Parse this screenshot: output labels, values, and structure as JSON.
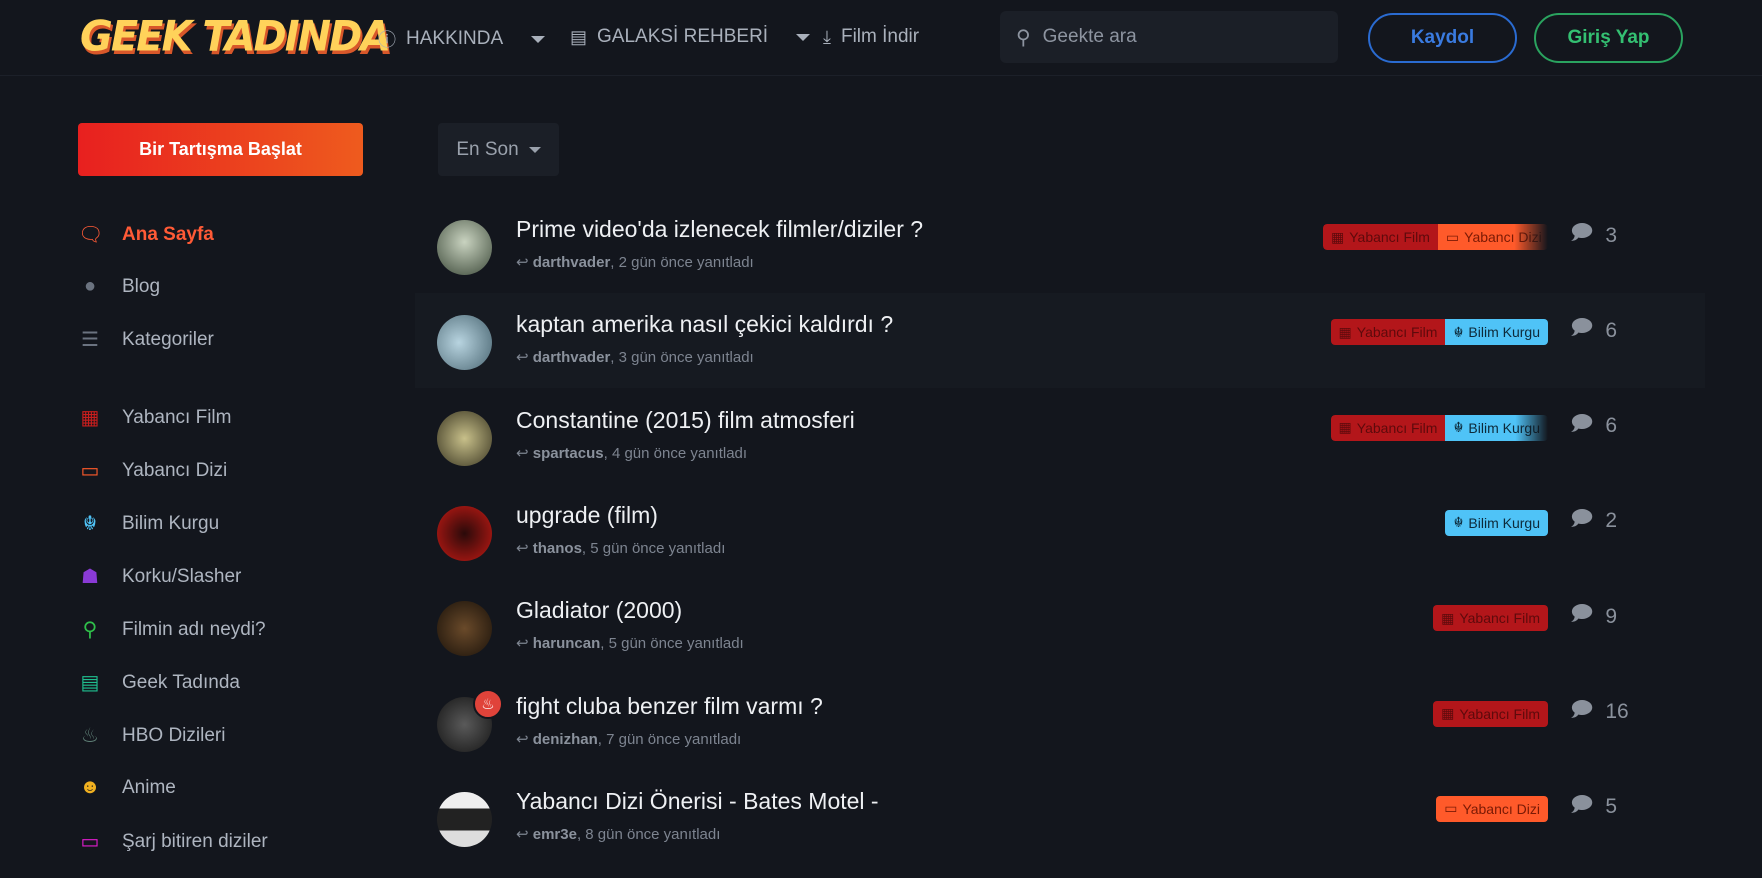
{
  "header": {
    "logo": "GEEK TADINDA",
    "nav": [
      {
        "label": "HAKKINDA",
        "icon": "info-circle-icon"
      },
      {
        "label": "GALAKSİ REHBERİ",
        "icon": "book-icon"
      },
      {
        "label": "Film İndir",
        "icon": "download-icon"
      }
    ],
    "search_placeholder": "Geekte ara",
    "signup": "Kaydol",
    "login": "Giriş Yap"
  },
  "sidebar": {
    "start_button": "Bir Tartışma Başlat",
    "items": [
      {
        "label": "Ana Sayfa",
        "icon": "comments-icon",
        "color": "#ff5a36",
        "active": true
      },
      {
        "label": "Blog",
        "icon": "comment-icon",
        "color": "#6b7380"
      },
      {
        "label": "Kategoriler",
        "icon": "list-icon",
        "color": "#6b7380"
      },
      {
        "label": "Yabancı Film",
        "icon": "film-icon",
        "color": "#c81d1d"
      },
      {
        "label": "Yabancı Dizi",
        "icon": "tv-icon",
        "color": "#ff5a2a"
      },
      {
        "label": "Bilim Kurgu",
        "icon": "jedi-icon",
        "color": "#4fc3f7"
      },
      {
        "label": "Korku/Slasher",
        "icon": "ghost-icon",
        "color": "#8a3ad6"
      },
      {
        "label": "Filmin adı neydi?",
        "icon": "search-icon",
        "color": "#2fbf4a"
      },
      {
        "label": "Geek Tadında",
        "icon": "book-icon",
        "color": "#1fbf8f"
      },
      {
        "label": "HBO Dizileri",
        "icon": "fire-icon",
        "color": "#5f7f76"
      },
      {
        "label": "Anime",
        "icon": "anime-icon",
        "color": "#f0b020"
      },
      {
        "label": "Şarj bitiren diziler",
        "icon": "battery-icon",
        "color": "#e21ccf"
      }
    ]
  },
  "sort": {
    "label": "En Son"
  },
  "tag_colors": {
    "Yabancı Film": "#b3161a",
    "Yabancı Dizi": "#ff5a2a",
    "Bilim Kurgu": "#4fc3f7"
  },
  "discussions": [
    {
      "title": "Prime video'da izlenecek filmler/diziler ?",
      "user": "darthvader",
      "time": ", 2 gün önce yanıtladı",
      "tags": [
        "Yabancı Film",
        "Yabancı Dizi"
      ],
      "replies": "3"
    },
    {
      "title": "kaptan amerika nasıl çekici kaldırdı ?",
      "user": "darthvader",
      "time": ", 3 gün önce yanıtladı",
      "tags": [
        "Yabancı Film",
        "Bilim Kurgu"
      ],
      "replies": "6"
    },
    {
      "title": "Constantine (2015) film atmosferi",
      "user": "spartacus",
      "time": ", 4 gün önce yanıtladı",
      "tags": [
        "Yabancı Film",
        "Bilim Kurgu"
      ],
      "replies": "6"
    },
    {
      "title": "upgrade (film)",
      "user": "thanos",
      "time": ", 5 gün önce yanıtladı",
      "tags": [
        "Bilim Kurgu"
      ],
      "replies": "2"
    },
    {
      "title": "Gladiator (2000)",
      "user": "haruncan",
      "time": ", 5 gün önce yanıtladı",
      "tags": [
        "Yabancı Film"
      ],
      "replies": "9"
    },
    {
      "title": "fight cluba benzer film varmı ?",
      "user": "denizhan",
      "time": ", 7 gün önce yanıtladı",
      "tags": [
        "Yabancı Film"
      ],
      "replies": "16"
    },
    {
      "title": "Yabancı Dizi Önerisi - Bates Motel -",
      "user": "emr3e",
      "time": ", 8 gün önce yanıtladı",
      "tags": [
        "Yabancı Dizi"
      ],
      "replies": "5"
    }
  ]
}
